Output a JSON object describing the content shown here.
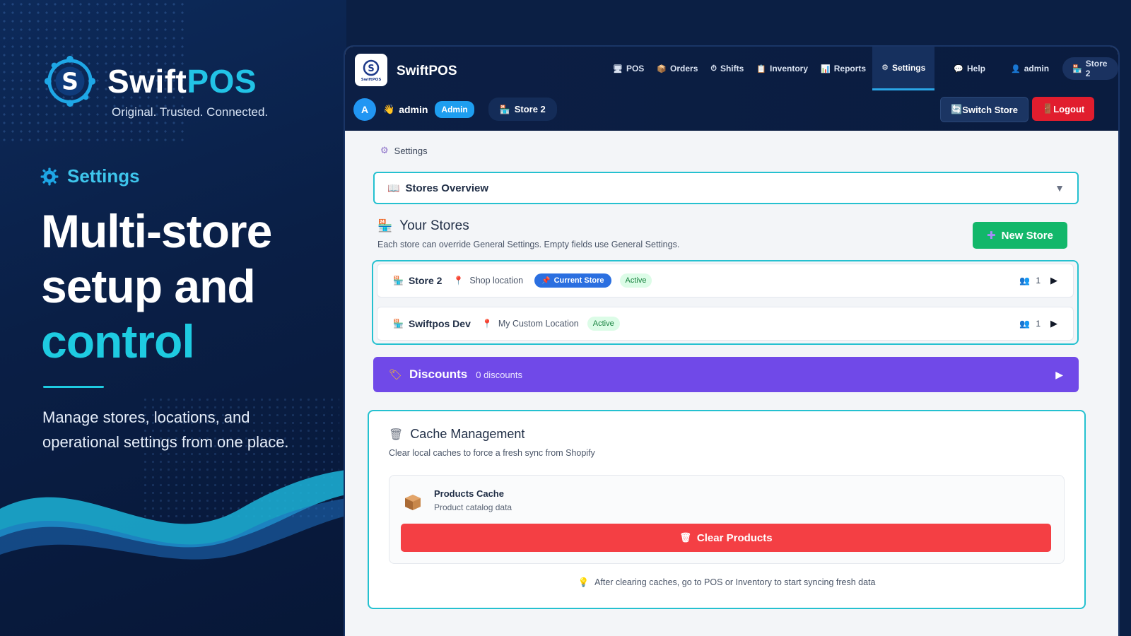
{
  "promo": {
    "brand_name_a": "Swift",
    "brand_name_b": "POS",
    "brand_tagline": "Original. Trusted. Connected.",
    "section_label": "Settings",
    "headline_1": "Multi-store",
    "headline_2": "setup and",
    "headline_3": "control",
    "description": "Manage stores, locations, and operational settings from one place."
  },
  "app": {
    "title": "SwiftPOS",
    "logo_text": "SwiftPOS",
    "nav": [
      {
        "icon": "monitor-icon",
        "glyph": "🖥",
        "label": "POS"
      },
      {
        "icon": "package-icon",
        "glyph": "📦",
        "label": "Orders"
      },
      {
        "icon": "clock-icon",
        "glyph": "⏱",
        "label": "Shifts"
      },
      {
        "icon": "clipboard-icon",
        "glyph": "📋",
        "label": "Inventory"
      },
      {
        "icon": "chart-icon",
        "glyph": "📊",
        "label": "Reports"
      },
      {
        "icon": "gear-icon",
        "glyph": "⚙",
        "label": "Settings"
      },
      {
        "icon": "chat-icon",
        "glyph": "💬",
        "label": "Help"
      },
      {
        "icon": "user-icon",
        "glyph": "👤",
        "label": "admin"
      },
      {
        "icon": "store-icon",
        "glyph": "🏪",
        "label": "Store 2"
      }
    ],
    "user": {
      "avatar_letter": "A",
      "greeting_name": "admin",
      "role": "Admin",
      "current_store": "Store 2"
    },
    "switch_store_label": "Switch Store",
    "logout_label": "Logout"
  },
  "content": {
    "breadcrumb": "Settings",
    "stores_overview": "Stores Overview",
    "your_stores_title": "Your Stores",
    "your_stores_subtitle": "Each store can override General Settings. Empty fields use General Settings.",
    "new_store_label": "New Store",
    "stores": [
      {
        "name": "Store 2",
        "location": "Shop location",
        "current_badge": "Current Store",
        "status": "Active",
        "users": "1"
      },
      {
        "name": "Swiftpos Dev",
        "location": "My Custom Location",
        "status": "Active",
        "users": "1"
      }
    ],
    "discounts_title": "Discounts",
    "discounts_count": "0 discounts",
    "cache": {
      "title": "Cache Management",
      "subtitle": "Clear local caches to force a fresh sync from Shopify",
      "item_title": "Products Cache",
      "item_subtitle": "Product catalog data",
      "clear_label": "Clear Products",
      "tip": "After clearing caches, go to POS or Inventory to start syncing fresh data"
    }
  },
  "colors": {
    "accent_teal": "#1ecbe1",
    "border_teal": "#25c1d0",
    "new_store_green": "#12b76a",
    "discounts_purple": "#7049e8",
    "danger_red": "#f43f44",
    "logout_red": "#e11d2e",
    "nav_bg": "#0c1f45"
  }
}
